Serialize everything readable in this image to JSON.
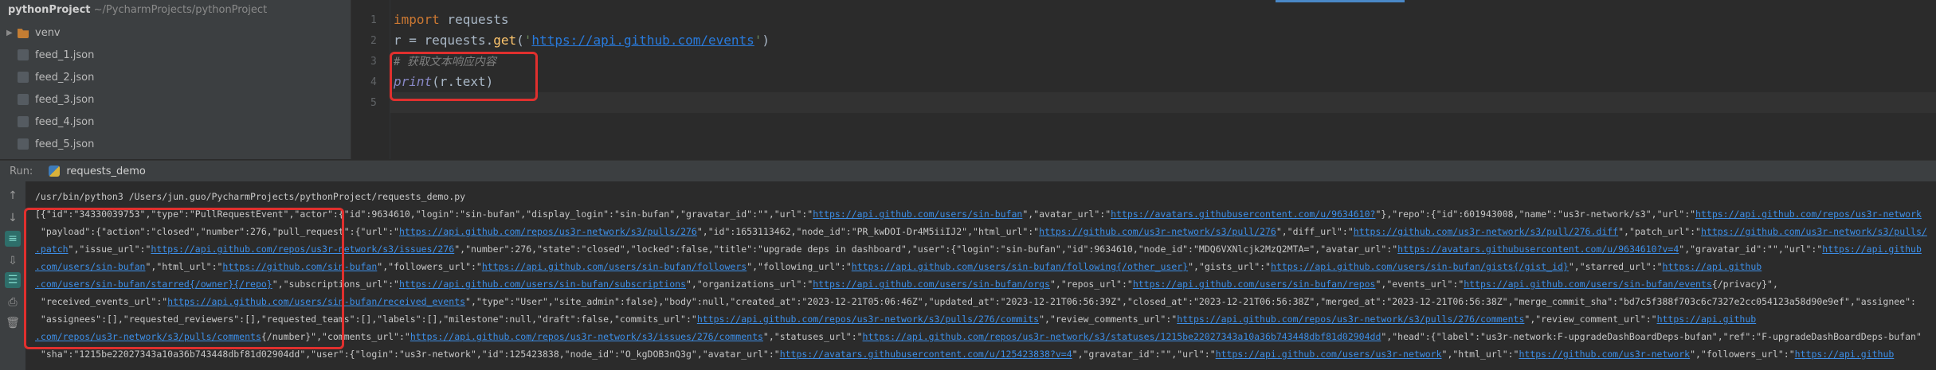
{
  "project": {
    "root_name": "pythonProject",
    "root_path": "~/PycharmProjects/pythonProject",
    "items": [
      {
        "label": "venv",
        "icon": "folder-icon"
      },
      {
        "label": "feed_1.json",
        "icon": "json-file-icon"
      },
      {
        "label": "feed_2.json",
        "icon": "json-file-icon"
      },
      {
        "label": "feed_3.json",
        "icon": "json-file-icon"
      },
      {
        "label": "feed_4.json",
        "icon": "json-file-icon"
      },
      {
        "label": "feed_5.json",
        "icon": "json-file-icon"
      }
    ]
  },
  "editor": {
    "line_numbers": [
      "1",
      "2",
      "3",
      "4",
      "5"
    ],
    "line1": {
      "kw": "import",
      "rest": " requests"
    },
    "line2": {
      "pre": "r = requests.",
      "fn": "get",
      "open": "(",
      "quote1": "'",
      "url": "https://api.github.com/events",
      "quote2": "'",
      "close": ")"
    },
    "line3": {
      "comment": "# 获取文本响应内容"
    },
    "line4": {
      "fn": "print",
      "rest": "(r.text)"
    }
  },
  "run_panel": {
    "label": "Run:",
    "tab_label": "requests_demo"
  },
  "console": {
    "command": "/usr/bin/python3 /Users/jun.guo/PycharmProjects/pythonProject/requests_demo.py",
    "lines": [
      [
        {
          "t": "[{\"id\":\"34330039753\",\"type\":\"PullRequestEvent\",\"actor\":{\"id\":9634610,\"login\":\"sin-bufan\",\"display_login\":\"sin-bufan\",\"gravatar_id\":\"\",\"url\":\""
        },
        {
          "u": "https://api.github.com/users/sin-bufan"
        },
        {
          "t": "\",\"avatar_url\":\""
        },
        {
          "u": "https://avatars.githubusercontent.com/u/9634610?"
        },
        {
          "t": "\"},\"repo\":{\"id\":601943008,\"name\":\"us3r-network/s3\",\"url\":\""
        },
        {
          "u": "https://api.github.com/repos/us3r-network"
        }
      ],
      [
        {
          "t": " \"payload\":{\"action\":\"closed\",\"number\":276,\"pull_request\":{\"url\":\""
        },
        {
          "u": "https://api.github.com/repos/us3r-network/s3/pulls/276"
        },
        {
          "t": "\",\"id\":1653113462,\"node_id\":\"PR_kwDOI-Dr4M5iiIJ2\",\"html_url\":\""
        },
        {
          "u": "https://github.com/us3r-network/s3/pull/276"
        },
        {
          "t": "\",\"diff_url\":\""
        },
        {
          "u": "https://github.com/us3r-network/s3/pull/276.diff"
        },
        {
          "t": "\",\"patch_url\":\""
        },
        {
          "u": "https://github.com/us3r-network/s3/pulls/"
        }
      ],
      [
        {
          "u": ".patch"
        },
        {
          "t": "\",\"issue_url\":\""
        },
        {
          "u": "https://api.github.com/repos/us3r-network/s3/issues/276"
        },
        {
          "t": "\",\"number\":276,\"state\":\"closed\",\"locked\":false,\"title\":\"upgrade deps in dashboard\",\"user\":{\"login\":\"sin-bufan\",\"id\":9634610,\"node_id\":\"MDQ6VXNlcjk2MzQ2MTA=\",\"avatar_url\":\""
        },
        {
          "u": "https://avatars.githubusercontent.com/u/9634610?v=4"
        },
        {
          "t": "\",\"gravatar_id\":\"\",\"url\":\""
        },
        {
          "u": "https://api.github"
        }
      ],
      [
        {
          "u": ".com/users/sin-bufan"
        },
        {
          "t": "\",\"html_url\":\""
        },
        {
          "u": "https://github.com/sin-bufan"
        },
        {
          "t": "\",\"followers_url\":\""
        },
        {
          "u": "https://api.github.com/users/sin-bufan/followers"
        },
        {
          "t": "\",\"following_url\":\""
        },
        {
          "u": "https://api.github.com/users/sin-bufan/following{/other_user}"
        },
        {
          "t": "\",\"gists_url\":\""
        },
        {
          "u": "https://api.github.com/users/sin-bufan/gists{/gist_id}"
        },
        {
          "t": "\",\"starred_url\":\""
        },
        {
          "u": "https://api.github"
        }
      ],
      [
        {
          "u": ".com/users/sin-bufan/starred{/owner}{/repo}"
        },
        {
          "t": "\",\"subscriptions_url\":\""
        },
        {
          "u": "https://api.github.com/users/sin-bufan/subscriptions"
        },
        {
          "t": "\",\"organizations_url\":\""
        },
        {
          "u": "https://api.github.com/users/sin-bufan/orgs"
        },
        {
          "t": "\",\"repos_url\":\""
        },
        {
          "u": "https://api.github.com/users/sin-bufan/repos"
        },
        {
          "t": "\",\"events_url\":\""
        },
        {
          "u": "https://api.github.com/users/sin-bufan/events"
        },
        {
          "t": "{/privacy}\","
        }
      ],
      [
        {
          "t": " \"received_events_url\":\""
        },
        {
          "u": "https://api.github.com/users/sin-bufan/received_events"
        },
        {
          "t": "\",\"type\":\"User\",\"site_admin\":false},\"body\":null,\"created_at\":\"2023-12-21T05:06:46Z\",\"updated_at\":\"2023-12-21T06:56:39Z\",\"closed_at\":\"2023-12-21T06:56:38Z\",\"merged_at\":\"2023-12-21T06:56:38Z\",\"merge_commit_sha\":\"bd7c5f388f703c6c7327e2cc054123a58d90e9ef\",\"assignee\":"
        }
      ],
      [
        {
          "t": " \"assignees\":[],\"requested_reviewers\":[],\"requested_teams\":[],\"labels\":[],\"milestone\":null,\"draft\":false,\"commits_url\":\""
        },
        {
          "u": "https://api.github.com/repos/us3r-network/s3/pulls/276/commits"
        },
        {
          "t": "\",\"review_comments_url\":\""
        },
        {
          "u": "https://api.github.com/repos/us3r-network/s3/pulls/276/comments"
        },
        {
          "t": "\",\"review_comment_url\":\""
        },
        {
          "u": "https://api.github"
        }
      ],
      [
        {
          "u": ".com/repos/us3r-network/s3/pulls/comments"
        },
        {
          "t": "{/number}\",\"comments_url\":\""
        },
        {
          "u": "https://api.github.com/repos/us3r-network/s3/issues/276/comments"
        },
        {
          "t": "\",\"statuses_url\":\""
        },
        {
          "u": "https://api.github.com/repos/us3r-network/s3/statuses/1215be22027343a10a36b743448dbf81d02904dd"
        },
        {
          "t": "\",\"head\":{\"label\":\"us3r-network:F-upgradeDashBoardDeps-bufan\",\"ref\":\"F-upgradeDashBoardDeps-bufan\""
        }
      ],
      [
        {
          "t": " \"sha\":\"1215be22027343a10a36b743448dbf81d02904dd\",\"user\":{\"login\":\"us3r-network\",\"id\":125423838,\"node_id\":\"O_kgDOB3nQ3g\",\"avatar_url\":\""
        },
        {
          "u": "https://avatars.githubusercontent.com/u/125423838?v=4"
        },
        {
          "t": "\",\"gravatar_id\":\"\",\"url\":\""
        },
        {
          "u": "https://api.github.com/users/us3r-network"
        },
        {
          "t": "\",\"html_url\":\""
        },
        {
          "u": "https://github.com/us3r-network"
        },
        {
          "t": "\",\"followers_url\":\""
        },
        {
          "u": "https://api.github"
        }
      ]
    ]
  },
  "colors": {
    "highlight_box": "#e0302e",
    "link": "#3d8fe8",
    "keyword": "#cc7832",
    "string": "#6a8759"
  }
}
